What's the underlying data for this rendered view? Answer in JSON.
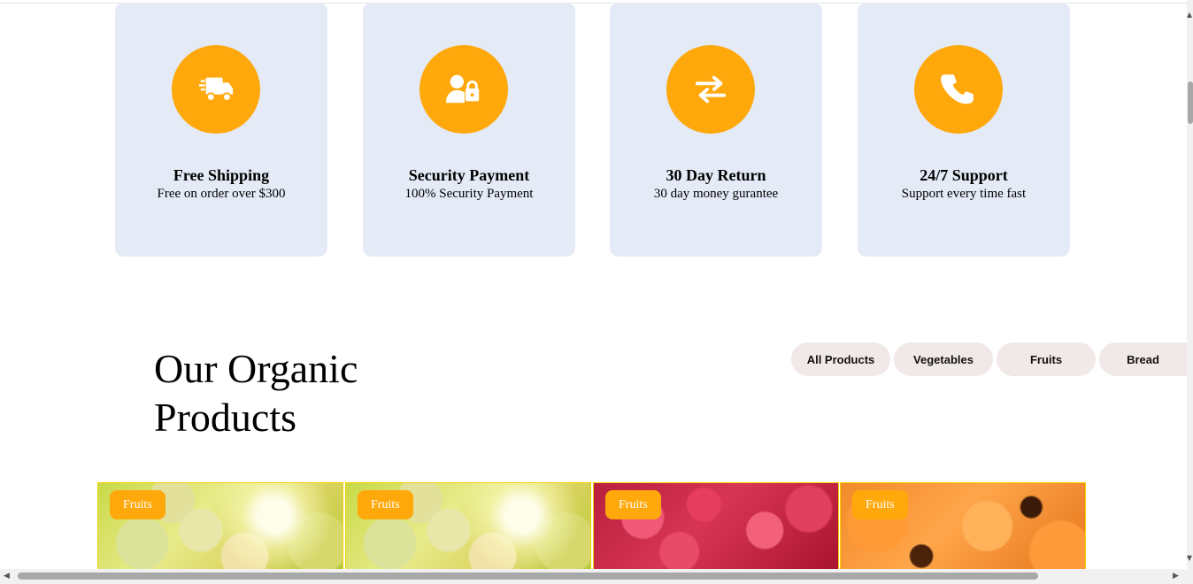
{
  "features": [
    {
      "title": "Free Shipping",
      "description": "Free on order over $300",
      "icon": "truck-fast-icon"
    },
    {
      "title": "Security Payment",
      "description": "100% Security Payment",
      "icon": "user-lock-icon"
    },
    {
      "title": "30 Day Return",
      "description": "30 day money gurantee",
      "icon": "exchange-arrows-icon"
    },
    {
      "title": "24/7 Support",
      "description": "Support every time fast",
      "icon": "phone-icon"
    }
  ],
  "products_section": {
    "title": "Our Organic Products",
    "tabs": [
      "All Products",
      "Vegetables",
      "Fruits",
      "Bread"
    ]
  },
  "products": [
    {
      "category": "Fruits",
      "image": "grapes"
    },
    {
      "category": "Fruits",
      "image": "grapes"
    },
    {
      "category": "Fruits",
      "image": "raspberries"
    },
    {
      "category": "Fruits",
      "image": "apricots"
    }
  ],
  "colors": {
    "accent": "#ffa80b",
    "card_bg": "#e4eaf6",
    "tab_bg": "#f1e8e8"
  }
}
